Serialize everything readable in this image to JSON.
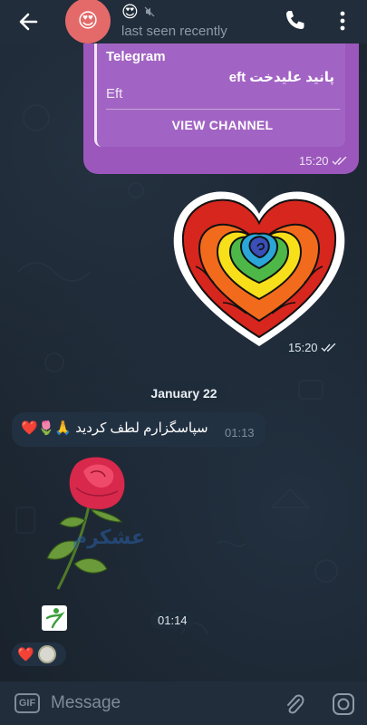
{
  "header": {
    "title_emoji": "😍",
    "status": "last seen recently",
    "avatar_emoji": "😍"
  },
  "channel_card": {
    "name": "Telegram",
    "description": "پانید علیدخت eft",
    "subtitle": "Eft",
    "button_label": "VIEW CHANNEL",
    "time": "15:20"
  },
  "sticker_message": {
    "time": "15:20"
  },
  "date_separator": "January 22",
  "incoming_message": {
    "text": "سپاسگزارم لطف کردید 🙏🌷❤️",
    "time": "01:13"
  },
  "rose_message": {
    "watermark": "عشکرم",
    "time": "01:14"
  },
  "reactions": {
    "heart": "❤️"
  },
  "input": {
    "gif_label": "GIF",
    "placeholder": "Message"
  },
  "colors": {
    "header_bg": "#212d3b",
    "bubble_purple": "#9b57bc",
    "incoming_bg": "#223142",
    "chat_bg": "#1a232d"
  }
}
